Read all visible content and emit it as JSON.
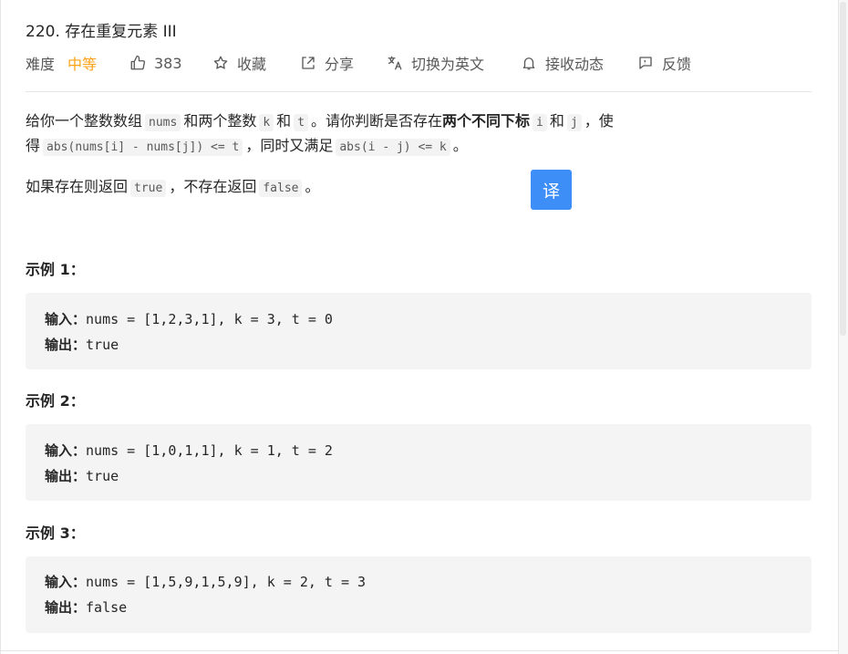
{
  "problem": {
    "title": "220. 存在重复元素 III",
    "difficulty_label": "难度",
    "difficulty": "中等",
    "likes": "383",
    "favorite_label": "收藏",
    "share_label": "分享",
    "switch_lang_label": "切换为英文",
    "subscribe_label": "接收动态",
    "feedback_label": "反馈",
    "translate_label": "译"
  },
  "description": {
    "l1_p1": "给你一个整数数组",
    "l1_c1": "nums",
    "l1_p2": "和两个整数",
    "l1_c2": "k",
    "l1_p3": "和",
    "l1_c3": "t",
    "l1_p4": "。请你判断是否存在",
    "l1_bold": "两个不同下标",
    "l1_c4": "i",
    "l1_p5": "和",
    "l1_c5": "j",
    "l1_p6": "，使",
    "l2_p1": "得",
    "l2_c1": "abs(nums[i] - nums[j]) <= t",
    "l2_p2": "，同时又满足",
    "l2_c2": "abs(i - j) <= k",
    "l2_p3": "。",
    "l3_p1": "如果存在则返回",
    "l3_c1": "true",
    "l3_p2": "，不存在返回",
    "l3_c2": "false",
    "l3_p3": "。"
  },
  "examples": [
    {
      "title": "示例 1：",
      "input_label": "输入：",
      "input": "nums = [1,2,3,1], k = 3, t = 0",
      "output_label": "输出：",
      "output": "true"
    },
    {
      "title": "示例 2：",
      "input_label": "输入：",
      "input": "nums = [1,0,1,1], k = 1, t = 2",
      "output_label": "输出：",
      "output": "true"
    },
    {
      "title": "示例 3：",
      "input_label": "输入：",
      "input": "nums = [1,5,9,1,5,9], k = 2, t = 3",
      "output_label": "输出：",
      "output": "false"
    }
  ],
  "colors": {
    "accent": "#ffa116",
    "translate_button": "#3e8ef7",
    "code_bg": "#f4f4f4"
  },
  "icons": [
    "thumbs-up-icon",
    "star-icon",
    "share-icon",
    "translate-icon",
    "bell-icon",
    "feedback-icon"
  ]
}
